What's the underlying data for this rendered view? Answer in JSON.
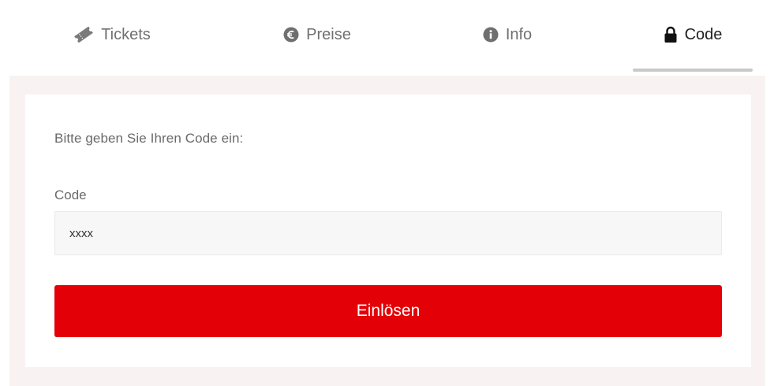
{
  "tabs": [
    {
      "label": "Tickets",
      "icon": "ticket-icon"
    },
    {
      "label": "Preise",
      "icon": "euro-circle-icon"
    },
    {
      "label": "Info",
      "icon": "info-circle-icon"
    },
    {
      "label": "Code",
      "icon": "lock-icon",
      "active": true
    }
  ],
  "form": {
    "prompt": "Bitte geben Sie Ihren Code ein:",
    "code_label": "Code",
    "code_value": "xxxx",
    "submit_label": "Einlösen"
  },
  "colors": {
    "accent": "#e30007",
    "panel_background": "#f8f3f2",
    "active_tab_underline": "#c9c9c9"
  }
}
